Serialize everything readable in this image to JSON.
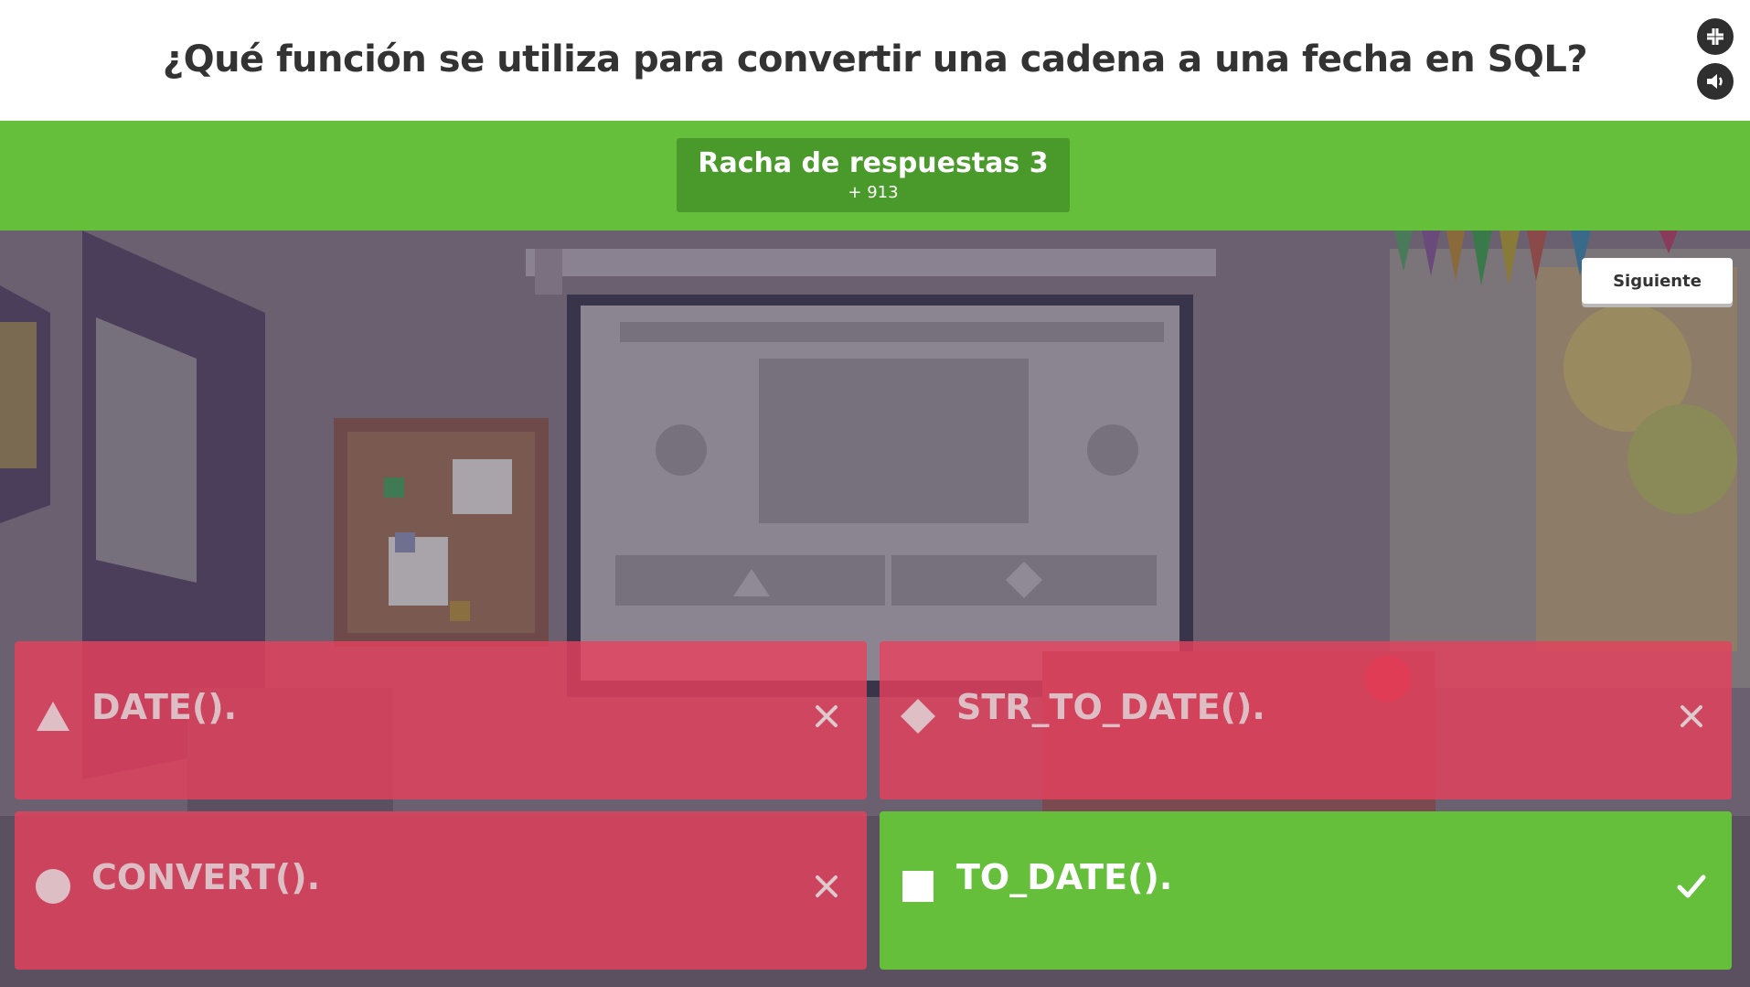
{
  "question": {
    "text": "¿Qué función se utiliza para convertir una cadena a una fecha en SQL?"
  },
  "header_icons": {
    "fullscreen": "fullscreen-icon",
    "sound": "sound-icon"
  },
  "streak": {
    "title": "Racha de respuestas 3",
    "points": "+ 913"
  },
  "next_button": {
    "label": "Siguiente"
  },
  "answers": [
    {
      "shape": "triangle-icon",
      "text": "DATE().",
      "status": "incorrect",
      "mark": "close-icon"
    },
    {
      "shape": "diamond-icon",
      "text": "STR_TO_DATE().",
      "status": "incorrect",
      "mark": "close-icon"
    },
    {
      "shape": "circle-icon",
      "text": "CONVERT().",
      "status": "incorrect",
      "mark": "close-icon"
    },
    {
      "shape": "square-icon",
      "text": "TO_DATE().",
      "status": "correct",
      "mark": "checkmark-icon"
    }
  ],
  "colors": {
    "green": "#65bf3a",
    "green_dark": "#4a9a2b",
    "wrong": "#e8405c",
    "header_text": "#333333"
  }
}
